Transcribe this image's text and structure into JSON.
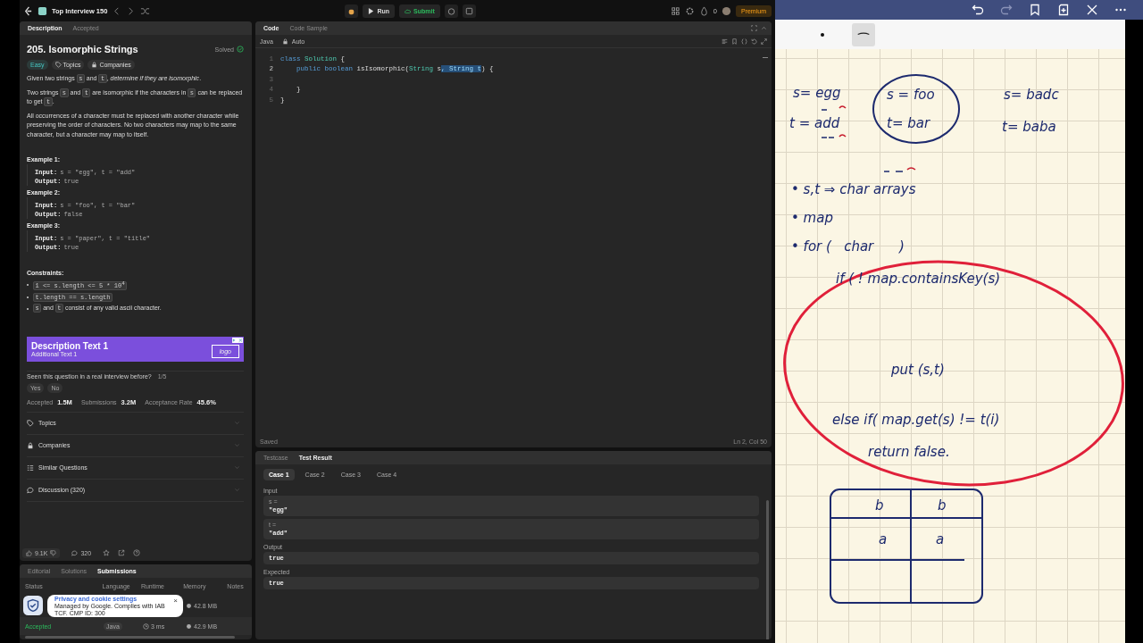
{
  "top_bar": {
    "list_title": "Top Interview 150",
    "run": "Run",
    "submit": "Submit",
    "coins": "0",
    "premium": "Premium"
  },
  "description": {
    "tabs": [
      {
        "label": "Description",
        "selected": true
      },
      {
        "label": "Accepted",
        "selected": false
      }
    ],
    "title": "205. Isomorphic Strings",
    "status": "Solved",
    "tags": [
      {
        "label": "Easy",
        "kind": "difficulty"
      },
      {
        "label": "Topics",
        "kind": "topics"
      },
      {
        "label": "Companies",
        "kind": "companies"
      }
    ],
    "paragraphs": [
      [
        {
          "kind": "text",
          "text": "Given two strings "
        },
        {
          "kind": "code",
          "text": "s"
        },
        {
          "kind": "text",
          "text": " and "
        },
        {
          "kind": "code",
          "text": "t"
        },
        {
          "kind": "text",
          "text": ", "
        },
        {
          "kind": "italic",
          "text": "determine if they are isomorphic"
        },
        {
          "kind": "text",
          "text": "."
        }
      ],
      [
        {
          "kind": "text",
          "text": "Two strings "
        },
        {
          "kind": "code",
          "text": "s"
        },
        {
          "kind": "text",
          "text": " and "
        },
        {
          "kind": "code",
          "text": "t"
        },
        {
          "kind": "text",
          "text": " are isomorphic if the characters in "
        },
        {
          "kind": "code",
          "text": "s"
        },
        {
          "kind": "text",
          "text": " can be replaced to get "
        },
        {
          "kind": "code",
          "text": "t"
        },
        {
          "kind": "text",
          "text": "."
        }
      ],
      [
        {
          "kind": "text",
          "text": "All occurrences of a character must be replaced with another character while preserving the order of characters. No two characters may map to the same character, but a character may map to itself."
        }
      ]
    ],
    "examples": [
      {
        "heading": "Example 1:",
        "input_label": "Input:",
        "input": "s = \"egg\", t = \"add\"",
        "output_label": "Output:",
        "output": "true"
      },
      {
        "heading": "Example 2:",
        "input_label": "Input:",
        "input": "s = \"foo\", t = \"bar\"",
        "output_label": "Output:",
        "output": "false"
      },
      {
        "heading": "Example 3:",
        "input_label": "Input:",
        "input": "s = \"paper\", t = \"title\"",
        "output_label": "Output:",
        "output": "true"
      }
    ],
    "constraints_heading": "Constraints:",
    "constraints": [
      [
        {
          "kind": "code",
          "text": "1 <= s.length <= 5 * 10$^{4}$"
        }
      ],
      [
        {
          "kind": "code",
          "text": "t.length == s.length"
        }
      ],
      [
        {
          "kind": "code",
          "text": "s"
        },
        {
          "kind": "text",
          "text": " and "
        },
        {
          "kind": "code",
          "text": "t"
        },
        {
          "kind": "text",
          "text": " consist of any valid ascii character."
        }
      ]
    ],
    "ad": {
      "title": "Description Text 1",
      "subtitle": "Additional Text 1",
      "logo": "logo"
    },
    "survey": {
      "question": "Seen this question in a real interview before?",
      "count": "1/5",
      "answers": [
        "Yes",
        "No"
      ]
    },
    "stats": [
      {
        "label": "Accepted",
        "value": "1.5M"
      },
      {
        "label": "Submissions",
        "value": "3.2M"
      },
      {
        "label": "Acceptance Rate",
        "value": "45.6%"
      }
    ],
    "sections": [
      {
        "label": "Topics",
        "kind": "tag"
      },
      {
        "label": "Companies",
        "kind": "lock"
      },
      {
        "label": "Similar Questions",
        "kind": "list"
      },
      {
        "label": "Discussion (320)",
        "kind": "chat"
      }
    ],
    "likes": "9.1K",
    "comments": "320"
  },
  "submissions": {
    "tabs": [
      {
        "label": "Editorial",
        "selected": false
      },
      {
        "label": "Solutions",
        "selected": false
      },
      {
        "label": "Submissions",
        "selected": true
      }
    ],
    "columns": [
      "Status",
      "Language",
      "Runtime",
      "Memory",
      "Notes"
    ],
    "rows": [
      {
        "memory": "42.8 MB"
      },
      {
        "status": "Accepted",
        "language": "Java",
        "runtime": "3 ms",
        "memory": "42.9 MB"
      }
    ]
  },
  "cookie_popup": {
    "title": "Privacy and cookie settings",
    "text": "Managed by Google. Complies with IAB TCF. CMP ID: 300",
    "close": "×"
  },
  "code": {
    "tabs": [
      {
        "label": "Code",
        "selected": true
      },
      {
        "label": "Code Sample",
        "selected": false
      }
    ],
    "language": "Java",
    "mode": "Auto",
    "lines": [
      {
        "number": "1",
        "tokens": [
          {
            "kind": "keyword",
            "text": "class "
          },
          {
            "kind": "type",
            "text": "Solution"
          },
          {
            "kind": "plain",
            "text": " {"
          }
        ]
      },
      {
        "number": "2",
        "tokens": [
          {
            "kind": "keyword",
            "text": "    public boolean "
          },
          {
            "kind": "plain",
            "text": "isIsomorphic("
          },
          {
            "kind": "type",
            "text": "String"
          },
          {
            "kind": "plain",
            "text": " s"
          },
          {
            "kind": "selection",
            "text": ", String t"
          },
          {
            "kind": "plain",
            "text": ") {"
          }
        ]
      },
      {
        "number": "3"
      },
      {
        "number": "4",
        "tokens": [
          {
            "kind": "plain",
            "text": "    }"
          }
        ]
      },
      {
        "number": "5",
        "tokens": [
          {
            "kind": "plain",
            "text": "}"
          }
        ]
      }
    ],
    "status": "Saved",
    "position": "Ln 2, Col 50"
  },
  "tests": {
    "tabs": [
      {
        "label": "Testcase",
        "selected": false
      },
      {
        "label": "Test Result",
        "selected": true
      }
    ],
    "cases": [
      {
        "label": "Case 1",
        "selected": true
      },
      {
        "label": "Case 2",
        "selected": false
      },
      {
        "label": "Case 3",
        "selected": false
      },
      {
        "label": "Case 4",
        "selected": false
      }
    ],
    "input_label": "Input",
    "inputs": [
      {
        "name": "s =",
        "value": "\"egg\""
      },
      {
        "name": "t =",
        "value": "\"add\""
      }
    ],
    "output_label": "Output",
    "output": "true",
    "expected_label": "Expected",
    "expected": "true"
  },
  "notes": {
    "texts": [
      "s= egg",
      "t = add",
      "s = foo",
      "t= bar",
      "s= badc",
      "t= baba",
      "• s,t ⇒ char arrays",
      "• map",
      "• for (   char      )",
      "if ( ! map.containsKey(s)",
      "put (s,t)",
      "else if( map.get(s) != t(i)",
      "return false."
    ],
    "table_cells": [
      "b",
      "b",
      "a",
      "a"
    ]
  }
}
